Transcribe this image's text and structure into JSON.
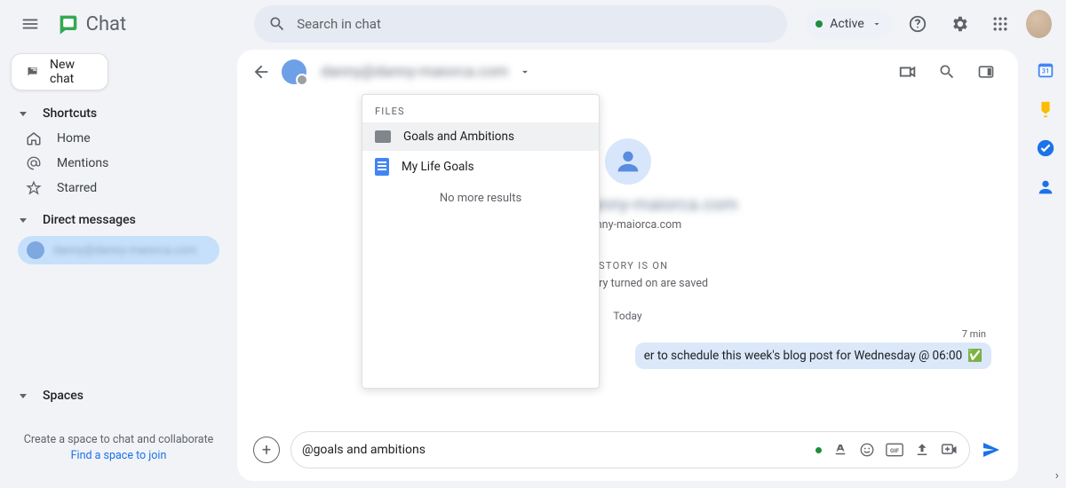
{
  "header": {
    "product": "Chat",
    "search_placeholder": "Search in chat",
    "status": "Active"
  },
  "sidebar": {
    "new_chat": "New chat",
    "shortcuts_label": "Shortcuts",
    "home": "Home",
    "mentions": "Mentions",
    "starred": "Starred",
    "dm_label": "Direct messages",
    "dm_item": "danny@danny-maiorca.com",
    "spaces_label": "Spaces",
    "help1": "Create a space to chat and collaborate",
    "help2": "Find a space to join"
  },
  "chat": {
    "peer": "danny@danny-maiorca.com",
    "center_email": "@danny-maiorca.com",
    "history_label": "HISTORY IS ON",
    "history_sub": "h the history turned on are saved",
    "today": "Today",
    "msg_time": "7 min",
    "msg_text": "er to schedule this week's blog post for Wednesday @ 06:00"
  },
  "composer": {
    "text": "@goals and ambitions"
  },
  "popover": {
    "section": "FILES",
    "item1": "Goals and Ambitions",
    "item2": "My Life Goals",
    "no_more": "No more results"
  }
}
